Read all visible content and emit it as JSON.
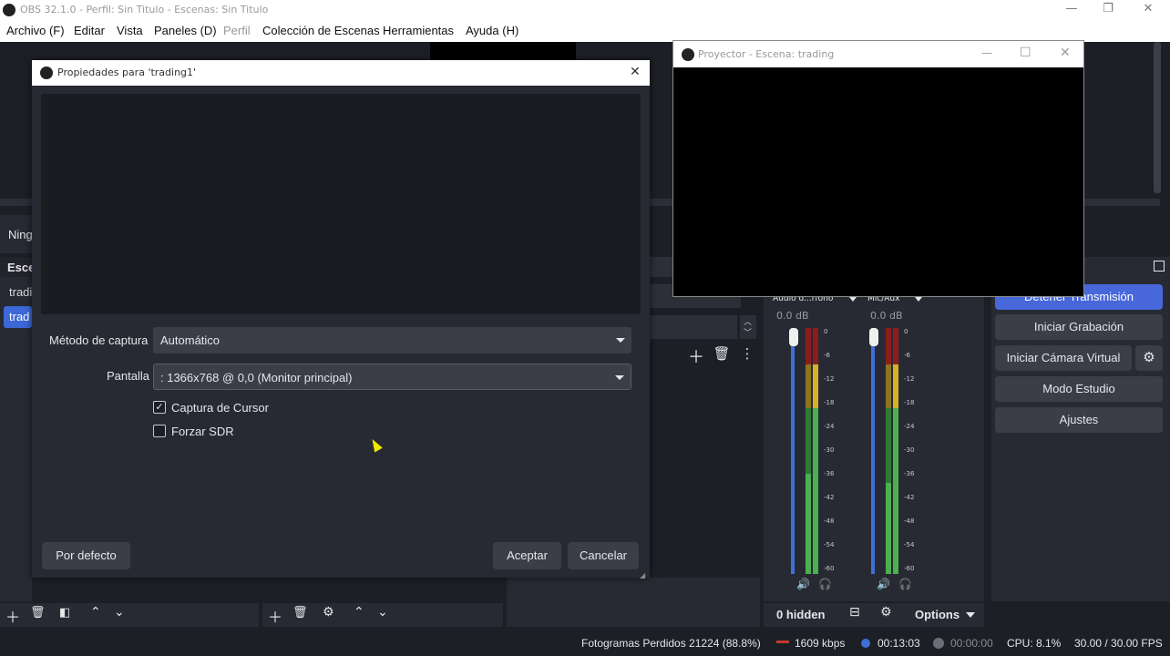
{
  "window": {
    "title": "OBS 32.1.0 - Perfil: Sin Titulo - Escenas: Sin Titulo",
    "minimize": "—",
    "maximize": "❐",
    "close": "✕"
  },
  "menu": {
    "archivo": "Archivo (F)",
    "editar": "Editar",
    "vista": "Vista",
    "paneles": "Paneles (D)",
    "perfil": "Perfil",
    "coleccion": "Colección de Escenas",
    "herramientas": "Herramientas",
    "ayuda": "Ayuda (H)"
  },
  "left_dock": {
    "source_label": "Ning",
    "scenes_header": "Esce",
    "scene_items": [
      "tradi",
      "trad"
    ],
    "selected_index": 1
  },
  "dialog": {
    "title": "Propiedades para 'trading1'",
    "close": "✕",
    "capture_method_label": "Método de captura",
    "capture_method_value": "Automático",
    "screen_label": "Pantalla",
    "screen_value": ": 1366x768 @ 0,0 (Monitor principal)",
    "cursor_capture": {
      "label": "Captura de Cursor",
      "checked": true
    },
    "force_sdr": {
      "label": "Forzar SDR",
      "checked": false
    },
    "defaults_button": "Por defecto",
    "accept_button": "Aceptar",
    "cancel_button": "Cancelar"
  },
  "projector": {
    "title": "Proyector - Escena: trading",
    "minimize": "—",
    "maximize": "☐",
    "close": "✕"
  },
  "mixer": {
    "channels": [
      {
        "name": "Audio d...rfono",
        "db": "0.0 dB"
      },
      {
        "name": "Mic/Aux",
        "db": "0.0 dB"
      }
    ],
    "ticks": [
      "0",
      "-6",
      "-12",
      "-18",
      "-24",
      "-30",
      "-36",
      "-42",
      "-48",
      "-54",
      "-60"
    ],
    "hidden_label": "0 hidden",
    "options_label": "Options"
  },
  "controls": {
    "stop_stream": "Detener Transmisión",
    "start_recording": "Iniciar Grabación",
    "start_virtual_cam": "Iniciar Cámara Virtual",
    "studio_mode": "Modo Estudio",
    "settings": "Ajustes"
  },
  "statusbar": {
    "dropped_frames": "Fotogramas Perdidos 21224 (88.8%)",
    "bitrate": "1609 kbps",
    "stream_time": "00:13:03",
    "rec_time": "00:00:00",
    "cpu": "CPU: 8.1%",
    "fps": "30.00 / 30.00 FPS"
  },
  "colors": {
    "accent": "#4767db",
    "panel": "#272a33",
    "background": "#1d1f26",
    "meter_green": "#4caf50",
    "meter_yellow": "#d6b028",
    "meter_red": "#c0392b",
    "cursor_yellow": "#f0e800"
  }
}
